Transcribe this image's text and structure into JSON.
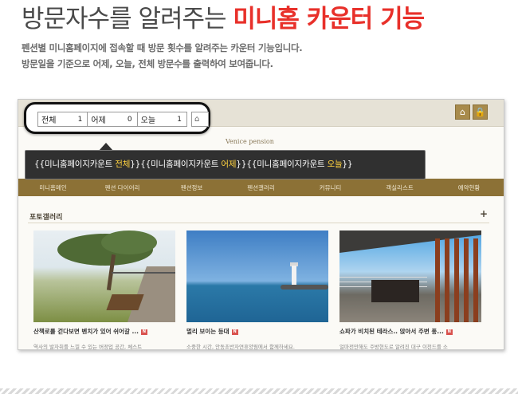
{
  "headline": {
    "normal": "방문자수를 알려주는 ",
    "accent": "미니홈 카운터 기능"
  },
  "description": {
    "line1": "펜션별 미니홈페이지에 접속할 때 방문 횟수를 알려주는 카운터 기능입니다.",
    "line2": "방문일을 기준으로 어제, 오늘, 전체 방문수를 출력하여 보여줍니다."
  },
  "colors": {
    "accent": "#e8302a",
    "nav": "#8c7136",
    "highlight": "#ffd23f"
  },
  "screenshot": {
    "brand": "Venice pension",
    "nav": [
      "미니홈메인",
      "펜션 다이어리",
      "펜션정보",
      "펜션갤러리",
      "커뮤니티",
      "객실리스트",
      "예약현황"
    ],
    "gallery_title": "포토갤러리",
    "gallery_more": "+",
    "cards": [
      {
        "caption": "산책로를 걷다보면 벤치가 있어 쉬어갈 ...",
        "badge": "N",
        "sub": "역사의 발자취를 느낄 수 있는 버정업 공간, 체스트"
      },
      {
        "caption": "멀리 보이는 등대",
        "badge": "N",
        "sub": "소중한 시간, 안동초반자연휴양림에서 함께하세요."
      },
      {
        "caption": "쇼파가 비치된 테라스.. 앉아서 주변 풍...",
        "badge": "N",
        "sub": "얼마전만해도 주방현도로 알려진 대구 이천드를 소"
      }
    ],
    "top_icons": [
      "home-icon",
      "lock-icon"
    ]
  },
  "counter": {
    "total_label": "전체",
    "total_value": "1",
    "yesterday_label": "어제",
    "yesterday_value": "0",
    "today_label": "오늘",
    "today_value": "1",
    "home_label": "⌂ D"
  },
  "tooltip": {
    "p1": "{{미니홈페이지카운트 ",
    "h1": "전체",
    "p2": "}}{{미니홈페이지카운트 ",
    "h2": "어제",
    "p3": "}}{{미니홈페이지카운트 ",
    "h3": "오늘",
    "p4": "}}"
  }
}
